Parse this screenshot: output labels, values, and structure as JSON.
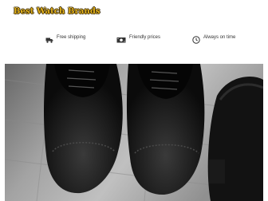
{
  "header": {
    "logo_text": "Best Watch Brands"
  },
  "features": [
    {
      "icon": "truck-icon",
      "label": "Free shipping"
    },
    {
      "icon": "money-icon",
      "label": "Friendly prices"
    },
    {
      "icon": "clock-icon",
      "label": "Always on time"
    }
  ],
  "hero": {
    "image": "black brogue shoes and leather bag on wooden floor"
  },
  "colors": {
    "logo": "#e3b21d",
    "logo_outline": "#3a2a05",
    "icon": "#333333"
  }
}
